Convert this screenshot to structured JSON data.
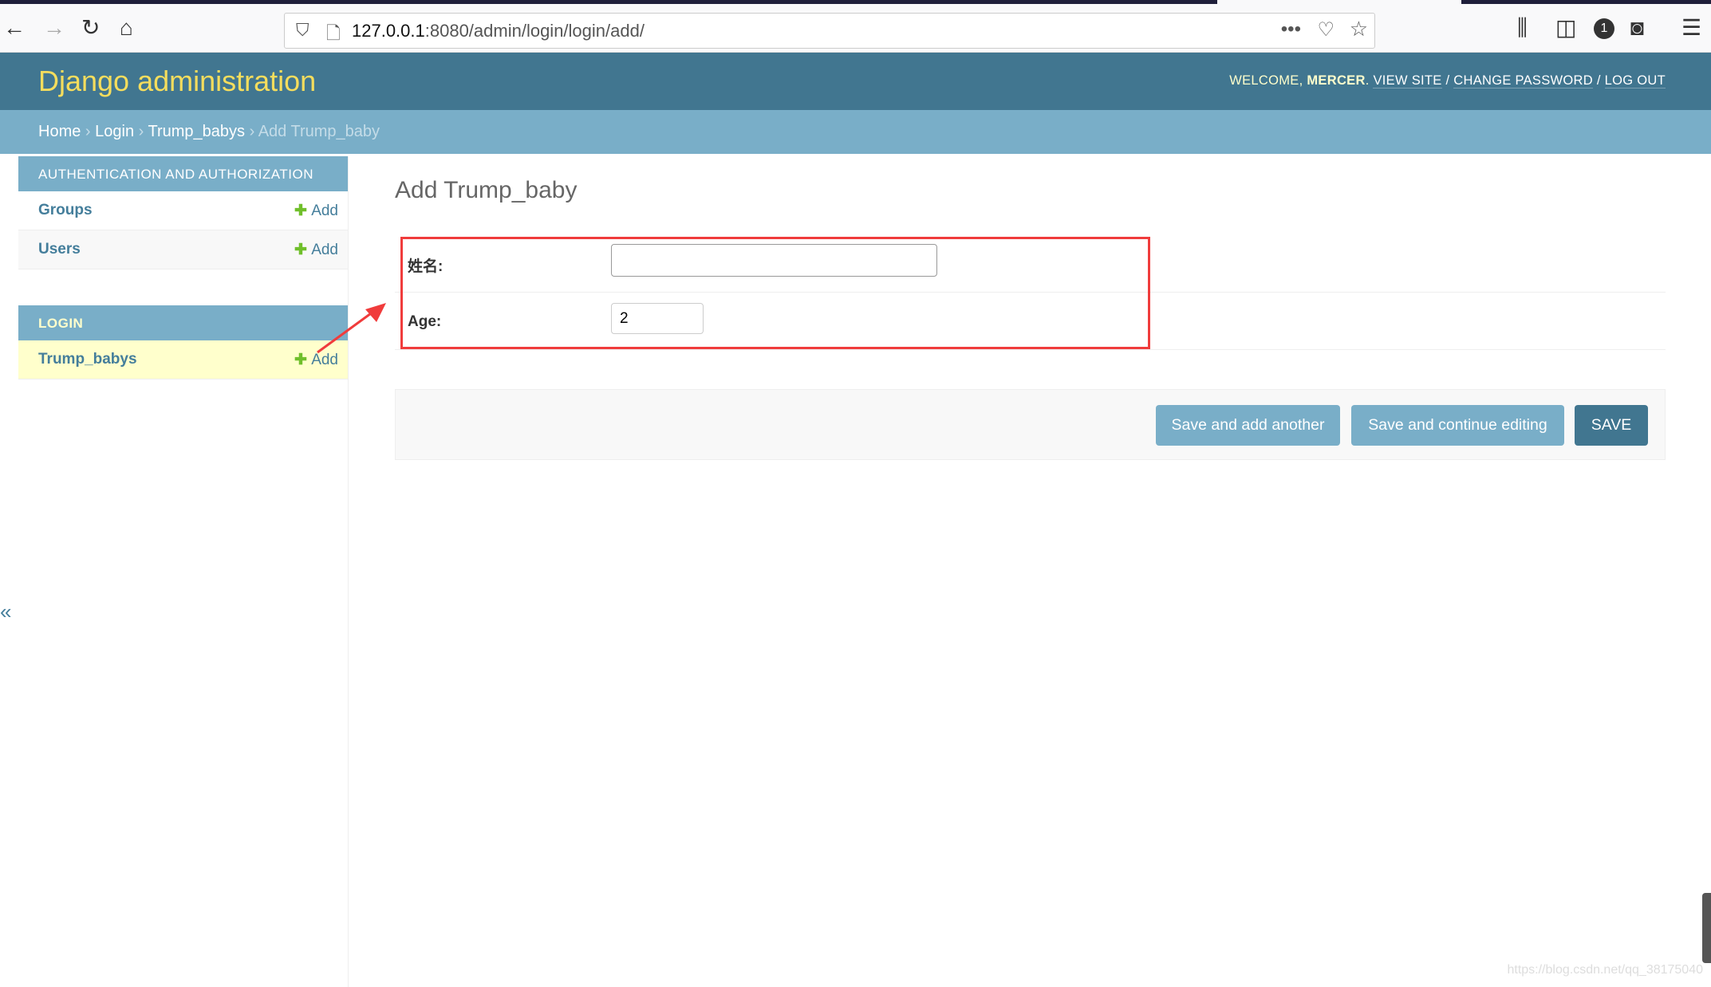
{
  "browser": {
    "url_host": "127.0.0.1",
    "url_rest": ":8080/admin/login/login/add/",
    "notifications_badge": "1"
  },
  "header": {
    "site_name": "Django administration",
    "welcome": "WELCOME, ",
    "user": "MERCER",
    "period": ". ",
    "view_site": "VIEW SITE",
    "sep": " / ",
    "change_password": "CHANGE PASSWORD",
    "log_out": "LOG OUT"
  },
  "breadcrumbs": {
    "home": "Home",
    "app": "Login",
    "model": "Trump_babys",
    "current": "Add Trump_baby",
    "sep": " › "
  },
  "sidebar": {
    "modules": [
      {
        "title": "AUTHENTICATION AND AUTHORIZATION",
        "items": [
          {
            "name": "Groups",
            "add": "Add"
          },
          {
            "name": "Users",
            "add": "Add"
          }
        ]
      },
      {
        "title": "LOGIN",
        "items": [
          {
            "name": "Trump_babys",
            "add": "Add",
            "selected": true
          }
        ]
      }
    ],
    "collapse": "«"
  },
  "main": {
    "title": "Add Trump_baby",
    "fields": [
      {
        "label": "姓名:",
        "value": ""
      },
      {
        "label": "Age:",
        "value": "2"
      }
    ],
    "buttons": {
      "save_add_another": "Save and add another",
      "save_continue": "Save and continue editing",
      "save": "Save"
    }
  },
  "annotation": {
    "highlight_color": "#f03c3c"
  },
  "watermark": "https://blog.csdn.net/qq_38175040",
  "colors": {
    "header": "#417690",
    "breadcrumb": "#79aec8",
    "site_name": "#f5dd5d",
    "selected_row": "#ffc",
    "add_plus": "#70bf2b"
  }
}
